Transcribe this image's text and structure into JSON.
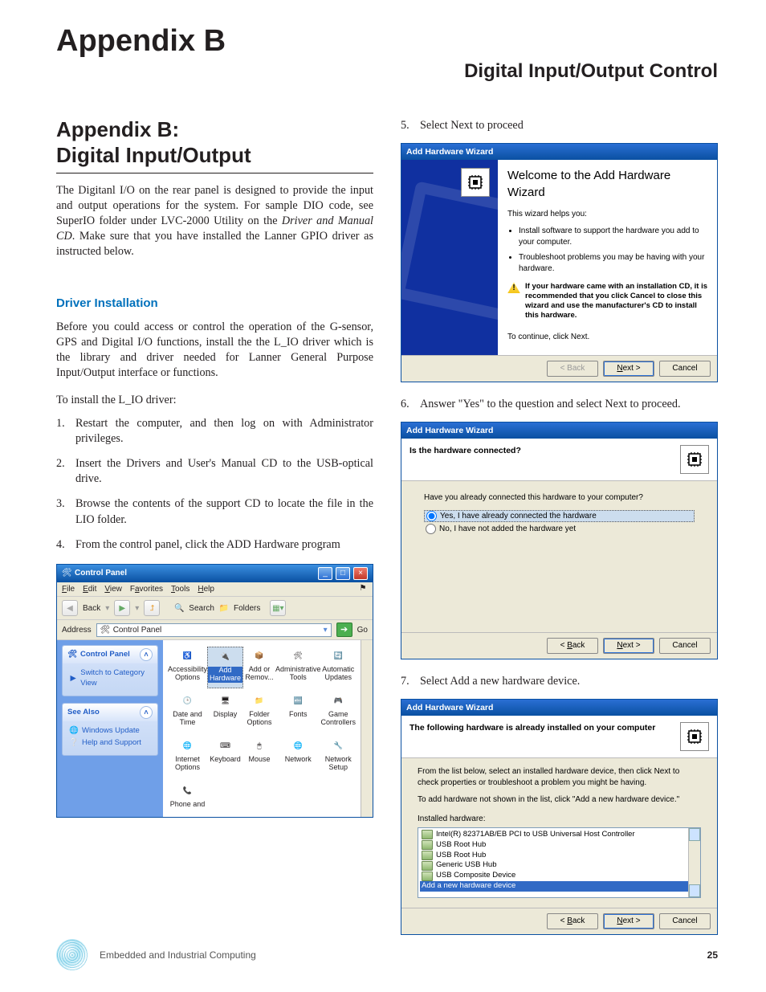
{
  "header": {
    "title": "Appendix B",
    "subtitle": "Digital Input/Output Control"
  },
  "left": {
    "h2a": "Appendix B:",
    "h2b": "Digital Input/Output",
    "intro_a": "The Digitanl I/O on the rear panel is designed to provide the input and output operations for the system.  For sample DIO code, see SuperIO folder under LVC-2000 Utility on the ",
    "intro_em": "Driver and  Manual CD",
    "intro_b": ". Make sure that you have installed the  Lanner GPIO driver as instructed below.",
    "h3": "Driver Installation",
    "p2": "Before you could access  or control the operation of the G-sensor, GPS and Digital I/O functions, install the the L_IO driver which is the library and driver needed for Lanner General Purpose Input/Output interface or functions.",
    "p3": "To install the L_IO driver:",
    "steps": [
      "Restart the computer, and then log on with Administrator privileges.",
      "Insert the Drivers and User's Manual CD to the USB-optical drive.",
      "Browse the contents of the support CD to locate the file in the  LIO folder.",
      "From the control panel, click the ADD Hardware program"
    ],
    "cp": {
      "title": "Control Panel",
      "menu": {
        "file": "File",
        "edit": "Edit",
        "view": "View",
        "fav": "Favorites",
        "tools": "Tools",
        "help": "Help"
      },
      "toolbar": {
        "back": "Back",
        "search": "Search",
        "folders": "Folders"
      },
      "address_label": "Address",
      "address_value": "Control Panel",
      "go": "Go",
      "panel1_title": "Control Panel",
      "panel1_link": "Switch to Category View",
      "panel2_title": "See Also",
      "panel2_links": [
        "Windows Update",
        "Help and Support"
      ],
      "items": [
        {
          "name": "Accessibility Options",
          "sel": false
        },
        {
          "name": "Add Hardware",
          "sel": true
        },
        {
          "name": "Add or Remov...",
          "sel": false
        },
        {
          "name": "Administrative Tools",
          "sel": false
        },
        {
          "name": "Automatic Updates",
          "sel": false
        },
        {
          "name": "Date and Time",
          "sel": false
        },
        {
          "name": "Display",
          "sel": false
        },
        {
          "name": "Folder Options",
          "sel": false
        },
        {
          "name": "Fonts",
          "sel": false
        },
        {
          "name": "Game Controllers",
          "sel": false
        },
        {
          "name": "Internet Options",
          "sel": false
        },
        {
          "name": "Keyboard",
          "sel": false
        },
        {
          "name": "Mouse",
          "sel": false
        },
        {
          "name": "Network",
          "sel": false
        },
        {
          "name": "Network Setup",
          "sel": false
        },
        {
          "name": "Phone and",
          "sel": false
        }
      ]
    }
  },
  "right": {
    "step5": "Select Next to proceed",
    "wiz_title": "Add Hardware Wizard",
    "wiz1": {
      "heading": "Welcome to the Add Hardware Wizard",
      "helps": "This wizard helps you:",
      "b1": "Install software to support the hardware you add to your computer.",
      "b2": "Troubleshoot problems you may be having with your hardware.",
      "warn": "If your hardware came with an installation CD, it is recommended that you click Cancel to close this wizard and use the manufacturer's CD to install this hardware.",
      "cont": "To continue, click Next.",
      "back": "< Back",
      "next": "Next >",
      "cancel": "Cancel"
    },
    "step6": "Answer \"Yes\" to the question and select Next to proceed.",
    "wiz2": {
      "q": "Is the hardware connected?",
      "prompt": "Have you already connected this hardware to your computer?",
      "opt1": "Yes, I have already connected the hardware",
      "opt2": "No, I have not added the hardware yet",
      "back": "< Back",
      "next": "Next >",
      "cancel": "Cancel"
    },
    "step7": "Select Add a new hardware device.",
    "wiz3": {
      "head": "The following hardware is already installed on your computer",
      "p1": "From the list below, select an installed hardware device, then click Next to check properties or troubleshoot a problem you might be having.",
      "p2": "To add hardware not shown in the list, click \"Add a new hardware device.\"",
      "listlabel": "Installed hardware:",
      "items": [
        "Intel(R) 82371AB/EB PCI to USB Universal Host Controller",
        "USB Root Hub",
        "USB Root Hub",
        "Generic USB Hub",
        "USB Composite Device"
      ],
      "sel": "Add a new hardware device",
      "back": "< Back",
      "next": "Next >",
      "cancel": "Cancel"
    }
  },
  "footer": {
    "text": "Embedded and Industrial Computing",
    "page": "25"
  }
}
